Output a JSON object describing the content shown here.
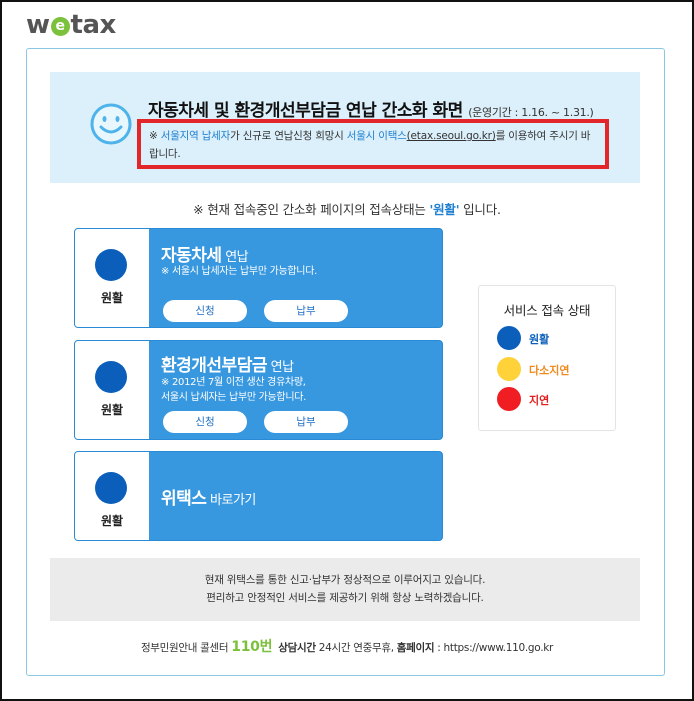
{
  "logo": {
    "pre": "w",
    "e": "e",
    "post": "tax"
  },
  "banner": {
    "title": "자동차세 및 환경개선부담금 연납 간소화 화면",
    "period": "(운영기간 : 1.16. ~ 1.31.)",
    "notice": {
      "mark": "※ ",
      "seoul_taxpayer": "서울지역 납세자",
      "mid": "가 신규로 연납신청 희망시 ",
      "etax_name": "서울시 이택스",
      "etax_url": "(etax.seoul.go.kr)",
      "tail": "를 이용하여 주시기 바랍니다."
    }
  },
  "status_line": {
    "prefix": "※ 현재 접속중인 간소화 페이지의 접속상태는 ",
    "value": "'원활'",
    "suffix": " 입니다."
  },
  "services": [
    {
      "status": "원활",
      "title": "자동차세",
      "title_sub": " 연납",
      "desc_lines": [
        "※ 서울시 납세자는 납부만 가능합니다."
      ],
      "buttons": [
        "신청",
        "납부"
      ]
    },
    {
      "status": "원활",
      "title": "환경개선부담금",
      "title_sub": " 연납",
      "desc_lines": [
        "※ 2012년 7월 이전 생산 경유차량,",
        "서울시 납세자는 납부만 가능합니다."
      ],
      "buttons": [
        "신청",
        "납부"
      ]
    },
    {
      "status": "원활",
      "title": "위택스",
      "title_sub": " 바로가기",
      "desc_lines": [],
      "buttons": []
    }
  ],
  "legend": {
    "title": "서비스 접속 상태",
    "items": [
      {
        "label": "원활",
        "color": "#0b5fbb",
        "text_color": "#0b5fbb"
      },
      {
        "label": "다소지연",
        "color": "#ffd23a",
        "text_color": "#f08a1c"
      },
      {
        "label": "지연",
        "color": "#f01e23",
        "text_color": "#e0201f"
      }
    ]
  },
  "bottom": {
    "line1": "현재 위택스를 통한 신고·납부가 정상적으로 이루어지고 있습니다.",
    "line2": "편리하고 안정적인 서비스를 제공하기 위해 항상 노력하겠습니다."
  },
  "footer": {
    "prefix": "정부민원안내 콜센터 ",
    "number": "110번",
    "hours_label": "상담시간",
    "hours": " 24시간 연중무휴, ",
    "homepage_label": "홈페이지",
    "homepage": " : https://www.110.go.kr"
  }
}
